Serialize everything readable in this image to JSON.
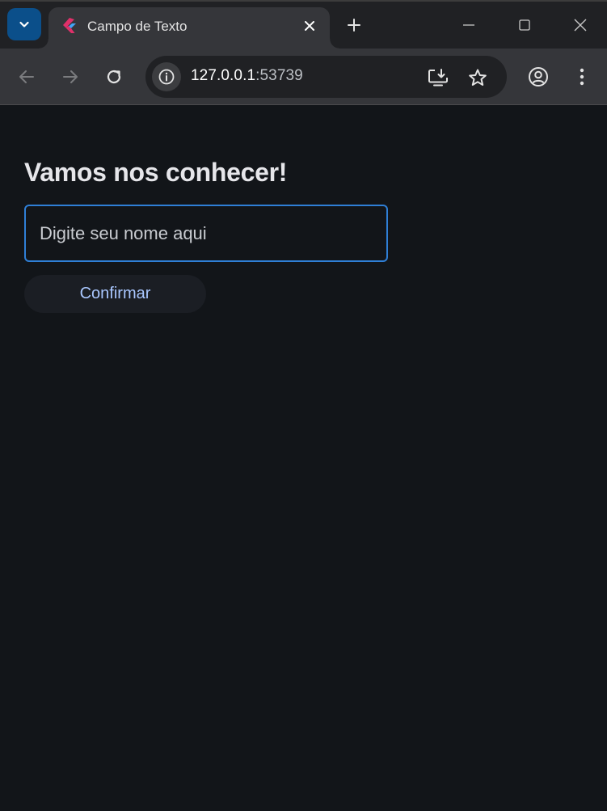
{
  "browser": {
    "tab": {
      "title": "Campo de Texto",
      "favicon": "flutter-logo-icon"
    },
    "address_bar": {
      "host": "127.0.0.1",
      "port_suffix": ":53739"
    },
    "icons": {
      "tab_search": "chevron-down-icon",
      "tab_close": "close-icon",
      "new_tab": "plus-icon",
      "minimize": "minimize-icon",
      "maximize": "maximize-icon",
      "close_window": "close-icon",
      "back": "back-arrow-icon",
      "forward": "forward-arrow-icon",
      "reload": "reload-icon",
      "site_info": "info-icon",
      "install_app": "install-app-icon",
      "bookmark": "star-icon",
      "profile": "profile-icon",
      "menu": "kebab-menu-icon"
    }
  },
  "page": {
    "heading": "Vamos nos conhecer!",
    "name_input": {
      "placeholder": "Digite seu nome aqui",
      "value": ""
    },
    "confirm_button": {
      "label": "Confirmar"
    }
  },
  "colors": {
    "page_background": "#121519",
    "input_border": "#2f7fd6",
    "button_text": "#a9c7ff",
    "tab_search_background": "#0b4f8a"
  }
}
